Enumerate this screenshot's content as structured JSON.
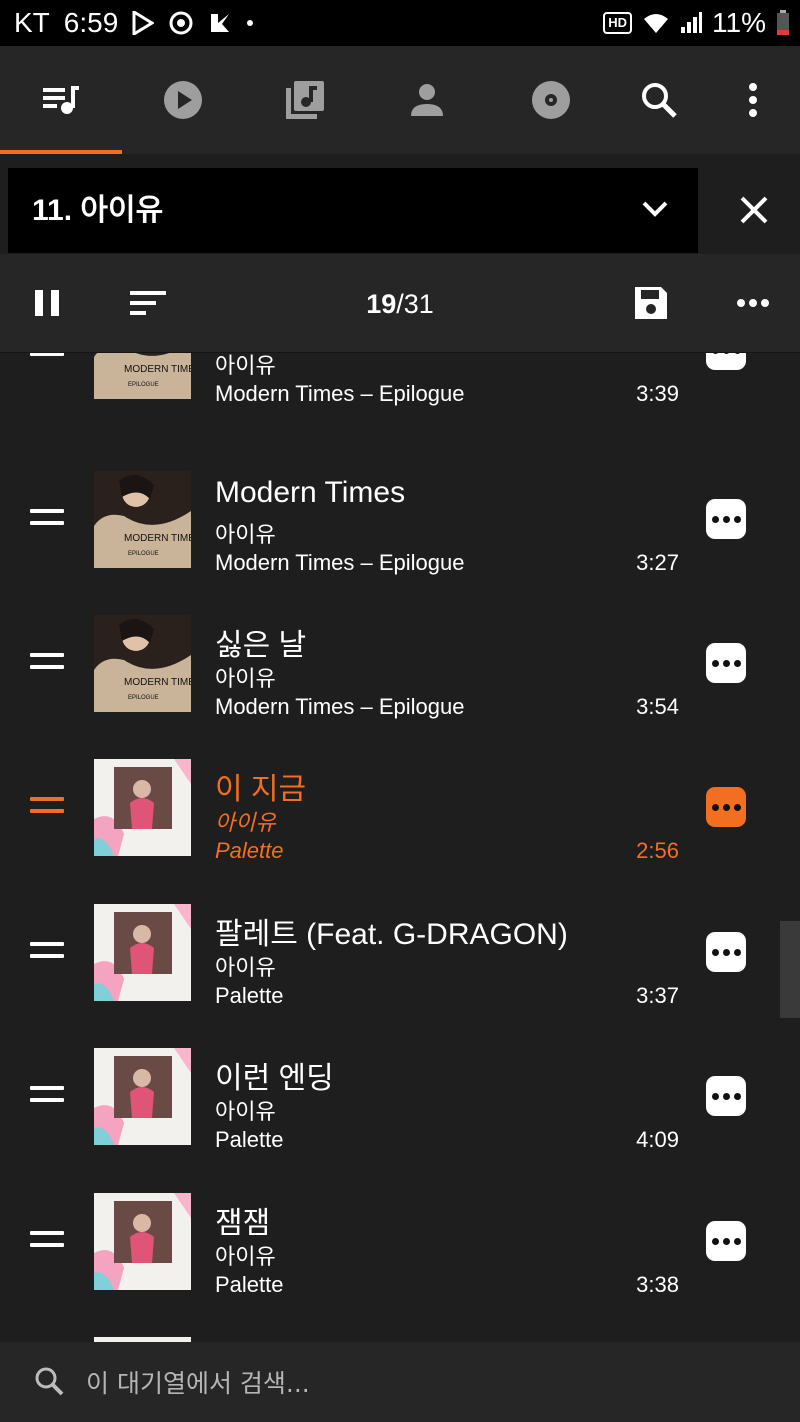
{
  "status_bar": {
    "carrier": "KT",
    "time": "6:59",
    "hd": "HD",
    "battery": "11%"
  },
  "nav": {
    "tabs": [
      {
        "name": "queue",
        "icon": "queue-music-icon",
        "active": true
      },
      {
        "name": "now-playing",
        "icon": "play-circle-icon"
      },
      {
        "name": "library",
        "icon": "music-library-icon"
      },
      {
        "name": "artists",
        "icon": "person-icon"
      },
      {
        "name": "albums",
        "icon": "disc-icon"
      }
    ]
  },
  "queue": {
    "title": "11. 아이유"
  },
  "toolbar": {
    "position": "19",
    "total": "/31"
  },
  "tracks": [
    {
      "title": "",
      "artist": "아이유",
      "album": "Modern Times – Epilogue",
      "duration": "3:39"
    },
    {
      "title": "Modern Times",
      "artist": "아이유",
      "album": "Modern Times – Epilogue",
      "duration": "3:27"
    },
    {
      "title": "싫은 날",
      "artist": "아이유",
      "album": "Modern Times – Epilogue",
      "duration": "3:54"
    },
    {
      "title": "이 지금",
      "artist": "아이유",
      "album": "Palette",
      "duration": "2:56",
      "playing": true
    },
    {
      "title": "팔레트 (Feat. G-DRAGON)",
      "artist": "아이유",
      "album": "Palette",
      "duration": "3:37"
    },
    {
      "title": "이런 엔딩",
      "artist": "아이유",
      "album": "Palette",
      "duration": "4:09"
    },
    {
      "title": "잼잼",
      "artist": "아이유",
      "album": "Palette",
      "duration": "3:38"
    }
  ],
  "album_art_text": {
    "modern_times": "MODERN TIMES",
    "epilogue": "EPILOGUE"
  },
  "search": {
    "placeholder": "이 대기열에서 검색..."
  },
  "colors": {
    "accent": "#f26e21",
    "background": "#1e1e1e",
    "toolbar": "#262626"
  }
}
